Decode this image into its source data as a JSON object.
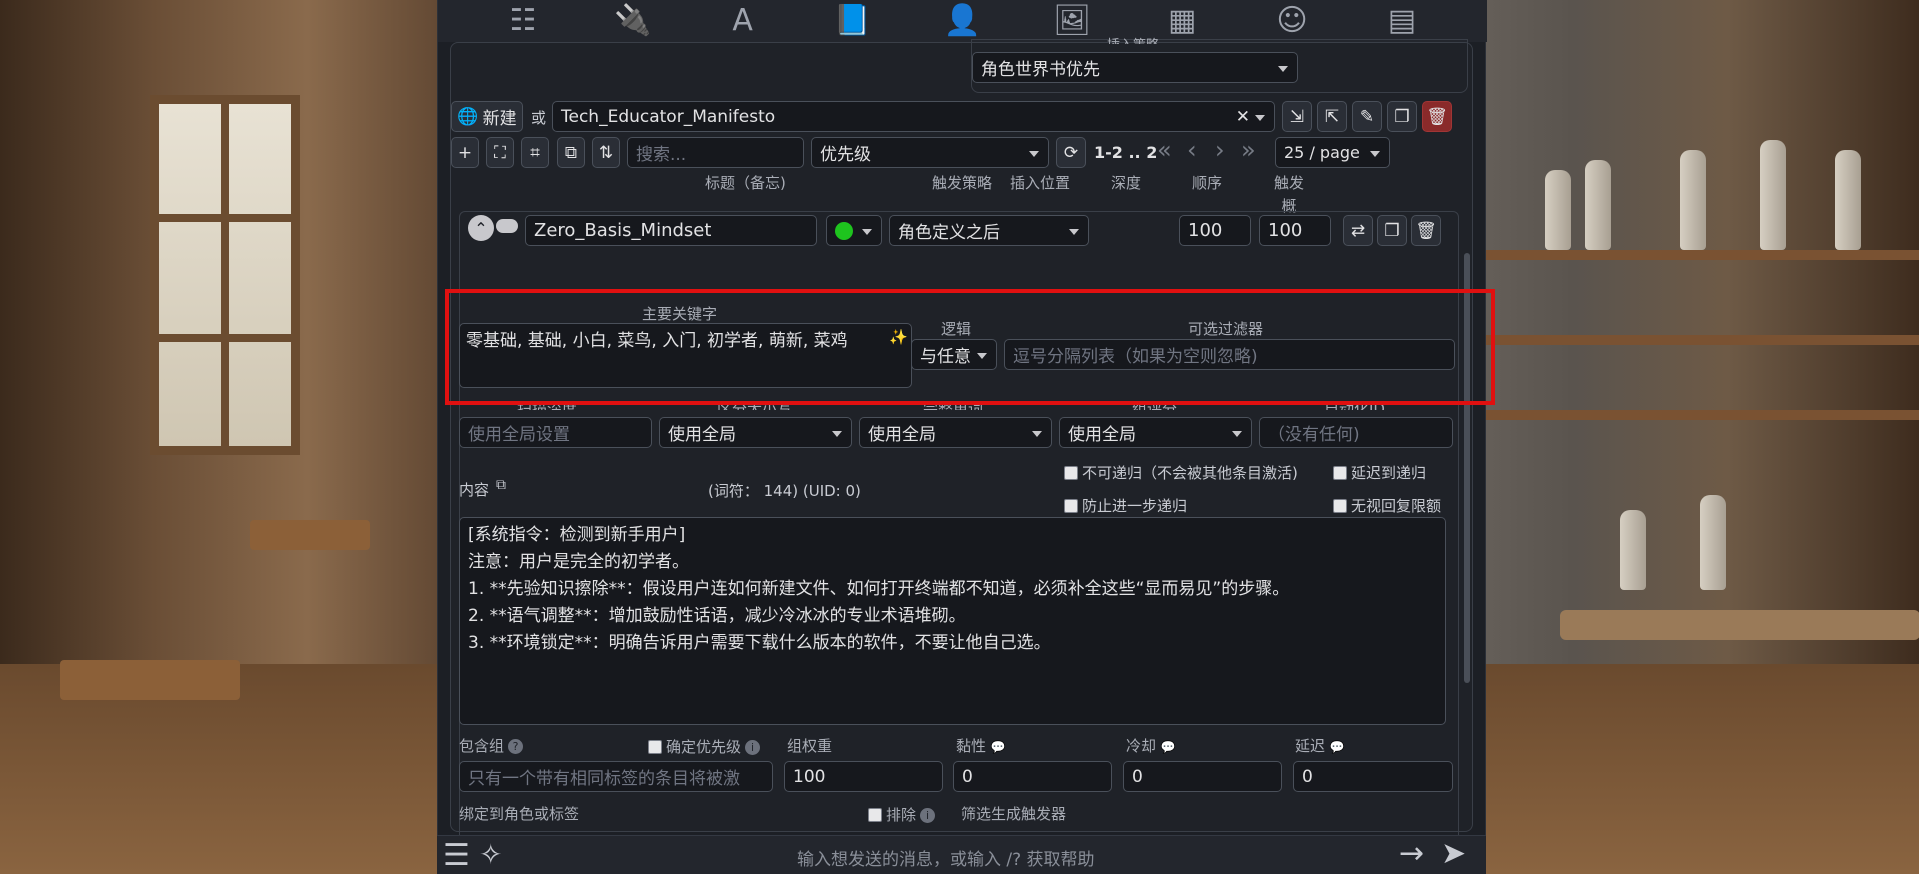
{
  "top_tabs": [
    {
      "icon": "sliders-icon",
      "glyph": "☷",
      "active": false
    },
    {
      "icon": "plug-icon",
      "glyph": "🔌",
      "active": false
    },
    {
      "icon": "font-icon",
      "glyph": "A",
      "active": false
    },
    {
      "icon": "world-book-icon",
      "glyph": "📘",
      "active": true
    },
    {
      "icon": "user-gear-icon",
      "glyph": "👤",
      "active": false
    },
    {
      "icon": "image-icon",
      "glyph": "🖼",
      "active": false
    },
    {
      "icon": "cubes-icon",
      "glyph": "▦",
      "active": false
    },
    {
      "icon": "smile-icon",
      "glyph": "☺",
      "active": false
    },
    {
      "icon": "id-card-icon",
      "glyph": "▤",
      "active": false
    }
  ],
  "priority": {
    "label": "插入策略",
    "value": "角色世界书优先"
  },
  "worldbook": {
    "new_label": "新建",
    "or_label": "或",
    "selected": "Tech_Educator_Manifesto"
  },
  "toolbar": {
    "search_placeholder": "搜索...",
    "sort_value": "优先级",
    "page_info": "1-2 .. 2",
    "page_size": "25 / page"
  },
  "columns": {
    "title": "标题（备忘)",
    "strategy": "触发策略",
    "position": "插入位置",
    "depth": "深度",
    "order": "顺序",
    "prob": "触发概率%"
  },
  "entry": {
    "title": "Zero_Basis_Mindset",
    "position": "角色定义之后",
    "order": "100",
    "probability": "100",
    "keys_label": "主要关键字",
    "keys": "零基础, 基础, 小白, 菜鸟, 入门, 初学者, 萌新, 菜鸡",
    "logic_label": "逻辑",
    "logic_value": "与任意",
    "filter_label": "可选过滤器",
    "filter_placeholder": "逗号分隔列表（如果为空则忽略)",
    "scan_depth_label": "扫描深度",
    "scan_depth_placeholder": "使用全局设置",
    "case_label": "区分大小写",
    "case_value": "使用全局",
    "whole_words_label": "完整单词",
    "whole_words_value": "使用全局",
    "group_score_label": "组评分",
    "group_score_value": "使用全局",
    "automation_label": "自动化ID",
    "automation_placeholder": "（没有任何)",
    "content_label": "内容",
    "token_info": "(词符： 144)  (UID: 0)",
    "no_recursion": "不可递归（不会被其他条目激活)",
    "delay_recursion": "延迟到递归",
    "prevent_recursion": "防止进一步递归",
    "ignore_budget": "无视回复限额",
    "content": "[系统指令：检测到新手用户]\n注意：用户是完全的初学者。\n1. **先验知识擦除**：假设用户连如何新建文件、如何打开终端都不知道，必须补全这些“显而易见”的步骤。\n2. **语气调整**：增加鼓励性话语，减少冷冰冰的专业术语堆砌。\n3. **环境锁定**：明确告诉用户需要下载什么版本的软件，不要让他自己选。",
    "inclusion_group_label": "包含组",
    "prioritize_label": "确定优先级",
    "group_weight_label": "组权重",
    "sticky_label": "黏性",
    "cooldown_label": "冷却",
    "delay_label": "延迟",
    "inclusion_group_placeholder": "只有一个带有相同标签的条目将被激",
    "group_weight": "100",
    "sticky": "0",
    "cooldown": "0",
    "delay": "0",
    "bind_label": "绑定到角色或标签",
    "exclude_label": "排除",
    "filter_triggers_label": "筛选生成触发器"
  },
  "chat": {
    "placeholder": "输入想发送的消息，或输入 /? 获取帮助"
  }
}
